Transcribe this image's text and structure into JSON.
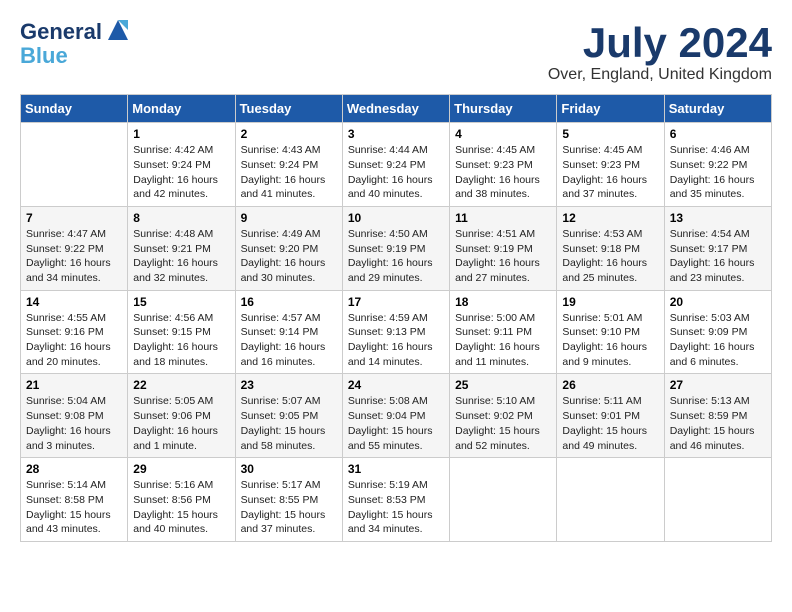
{
  "logo": {
    "line1": "General",
    "line2": "Blue"
  },
  "title": "July 2024",
  "location": "Over, England, United Kingdom",
  "days_of_week": [
    "Sunday",
    "Monday",
    "Tuesday",
    "Wednesday",
    "Thursday",
    "Friday",
    "Saturday"
  ],
  "weeks": [
    [
      {
        "num": "",
        "sunrise": "",
        "sunset": "",
        "daylight": ""
      },
      {
        "num": "1",
        "sunrise": "Sunrise: 4:42 AM",
        "sunset": "Sunset: 9:24 PM",
        "daylight": "Daylight: 16 hours and 42 minutes."
      },
      {
        "num": "2",
        "sunrise": "Sunrise: 4:43 AM",
        "sunset": "Sunset: 9:24 PM",
        "daylight": "Daylight: 16 hours and 41 minutes."
      },
      {
        "num": "3",
        "sunrise": "Sunrise: 4:44 AM",
        "sunset": "Sunset: 9:24 PM",
        "daylight": "Daylight: 16 hours and 40 minutes."
      },
      {
        "num": "4",
        "sunrise": "Sunrise: 4:45 AM",
        "sunset": "Sunset: 9:23 PM",
        "daylight": "Daylight: 16 hours and 38 minutes."
      },
      {
        "num": "5",
        "sunrise": "Sunrise: 4:45 AM",
        "sunset": "Sunset: 9:23 PM",
        "daylight": "Daylight: 16 hours and 37 minutes."
      },
      {
        "num": "6",
        "sunrise": "Sunrise: 4:46 AM",
        "sunset": "Sunset: 9:22 PM",
        "daylight": "Daylight: 16 hours and 35 minutes."
      }
    ],
    [
      {
        "num": "7",
        "sunrise": "Sunrise: 4:47 AM",
        "sunset": "Sunset: 9:22 PM",
        "daylight": "Daylight: 16 hours and 34 minutes."
      },
      {
        "num": "8",
        "sunrise": "Sunrise: 4:48 AM",
        "sunset": "Sunset: 9:21 PM",
        "daylight": "Daylight: 16 hours and 32 minutes."
      },
      {
        "num": "9",
        "sunrise": "Sunrise: 4:49 AM",
        "sunset": "Sunset: 9:20 PM",
        "daylight": "Daylight: 16 hours and 30 minutes."
      },
      {
        "num": "10",
        "sunrise": "Sunrise: 4:50 AM",
        "sunset": "Sunset: 9:19 PM",
        "daylight": "Daylight: 16 hours and 29 minutes."
      },
      {
        "num": "11",
        "sunrise": "Sunrise: 4:51 AM",
        "sunset": "Sunset: 9:19 PM",
        "daylight": "Daylight: 16 hours and 27 minutes."
      },
      {
        "num": "12",
        "sunrise": "Sunrise: 4:53 AM",
        "sunset": "Sunset: 9:18 PM",
        "daylight": "Daylight: 16 hours and 25 minutes."
      },
      {
        "num": "13",
        "sunrise": "Sunrise: 4:54 AM",
        "sunset": "Sunset: 9:17 PM",
        "daylight": "Daylight: 16 hours and 23 minutes."
      }
    ],
    [
      {
        "num": "14",
        "sunrise": "Sunrise: 4:55 AM",
        "sunset": "Sunset: 9:16 PM",
        "daylight": "Daylight: 16 hours and 20 minutes."
      },
      {
        "num": "15",
        "sunrise": "Sunrise: 4:56 AM",
        "sunset": "Sunset: 9:15 PM",
        "daylight": "Daylight: 16 hours and 18 minutes."
      },
      {
        "num": "16",
        "sunrise": "Sunrise: 4:57 AM",
        "sunset": "Sunset: 9:14 PM",
        "daylight": "Daylight: 16 hours and 16 minutes."
      },
      {
        "num": "17",
        "sunrise": "Sunrise: 4:59 AM",
        "sunset": "Sunset: 9:13 PM",
        "daylight": "Daylight: 16 hours and 14 minutes."
      },
      {
        "num": "18",
        "sunrise": "Sunrise: 5:00 AM",
        "sunset": "Sunset: 9:11 PM",
        "daylight": "Daylight: 16 hours and 11 minutes."
      },
      {
        "num": "19",
        "sunrise": "Sunrise: 5:01 AM",
        "sunset": "Sunset: 9:10 PM",
        "daylight": "Daylight: 16 hours and 9 minutes."
      },
      {
        "num": "20",
        "sunrise": "Sunrise: 5:03 AM",
        "sunset": "Sunset: 9:09 PM",
        "daylight": "Daylight: 16 hours and 6 minutes."
      }
    ],
    [
      {
        "num": "21",
        "sunrise": "Sunrise: 5:04 AM",
        "sunset": "Sunset: 9:08 PM",
        "daylight": "Daylight: 16 hours and 3 minutes."
      },
      {
        "num": "22",
        "sunrise": "Sunrise: 5:05 AM",
        "sunset": "Sunset: 9:06 PM",
        "daylight": "Daylight: 16 hours and 1 minute."
      },
      {
        "num": "23",
        "sunrise": "Sunrise: 5:07 AM",
        "sunset": "Sunset: 9:05 PM",
        "daylight": "Daylight: 15 hours and 58 minutes."
      },
      {
        "num": "24",
        "sunrise": "Sunrise: 5:08 AM",
        "sunset": "Sunset: 9:04 PM",
        "daylight": "Daylight: 15 hours and 55 minutes."
      },
      {
        "num": "25",
        "sunrise": "Sunrise: 5:10 AM",
        "sunset": "Sunset: 9:02 PM",
        "daylight": "Daylight: 15 hours and 52 minutes."
      },
      {
        "num": "26",
        "sunrise": "Sunrise: 5:11 AM",
        "sunset": "Sunset: 9:01 PM",
        "daylight": "Daylight: 15 hours and 49 minutes."
      },
      {
        "num": "27",
        "sunrise": "Sunrise: 5:13 AM",
        "sunset": "Sunset: 8:59 PM",
        "daylight": "Daylight: 15 hours and 46 minutes."
      }
    ],
    [
      {
        "num": "28",
        "sunrise": "Sunrise: 5:14 AM",
        "sunset": "Sunset: 8:58 PM",
        "daylight": "Daylight: 15 hours and 43 minutes."
      },
      {
        "num": "29",
        "sunrise": "Sunrise: 5:16 AM",
        "sunset": "Sunset: 8:56 PM",
        "daylight": "Daylight: 15 hours and 40 minutes."
      },
      {
        "num": "30",
        "sunrise": "Sunrise: 5:17 AM",
        "sunset": "Sunset: 8:55 PM",
        "daylight": "Daylight: 15 hours and 37 minutes."
      },
      {
        "num": "31",
        "sunrise": "Sunrise: 5:19 AM",
        "sunset": "Sunset: 8:53 PM",
        "daylight": "Daylight: 15 hours and 34 minutes."
      },
      {
        "num": "",
        "sunrise": "",
        "sunset": "",
        "daylight": ""
      },
      {
        "num": "",
        "sunrise": "",
        "sunset": "",
        "daylight": ""
      },
      {
        "num": "",
        "sunrise": "",
        "sunset": "",
        "daylight": ""
      }
    ]
  ]
}
